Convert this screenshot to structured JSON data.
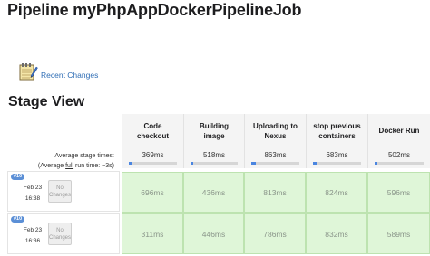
{
  "page": {
    "title": "Pipeline myPhpAppDockerPipelineJob"
  },
  "links": {
    "recent_changes": "Recent Changes",
    "recent_changes_icon": "notepad-icon"
  },
  "stage_view": {
    "title": "Stage View",
    "average_label": "Average stage times:",
    "full_run_prefix": "(Average ",
    "full_run_link": "full",
    "full_run_suffix": " run time: ~3s)",
    "stages": [
      {
        "name": "Code checkout",
        "avg": "369ms",
        "avg_fraction": 0.05
      },
      {
        "name": "Building image",
        "avg": "518ms",
        "avg_fraction": 0.06
      },
      {
        "name": "Uploading to Nexus",
        "avg": "863ms",
        "avg_fraction": 0.1
      },
      {
        "name": "stop previous containers",
        "avg": "683ms",
        "avg_fraction": 0.08
      },
      {
        "name": "Docker Run",
        "avg": "502ms",
        "avg_fraction": 0.06
      }
    ],
    "runs": [
      {
        "badge": "#10",
        "date": "Feb 23",
        "time": "16:38",
        "changes": "No Changes",
        "durations": [
          "696ms",
          "436ms",
          "813ms",
          "824ms",
          "596ms"
        ]
      },
      {
        "badge": "#10",
        "date": "Feb 23",
        "time": "16:36",
        "changes": "No Changes",
        "durations": [
          "311ms",
          "446ms",
          "786ms",
          "832ms",
          "589ms"
        ]
      }
    ]
  },
  "colors": {
    "success_cell": "#dff6d8",
    "progress": "#4a85e0",
    "link": "#2e6db5",
    "badge": "#5b8fd6"
  }
}
